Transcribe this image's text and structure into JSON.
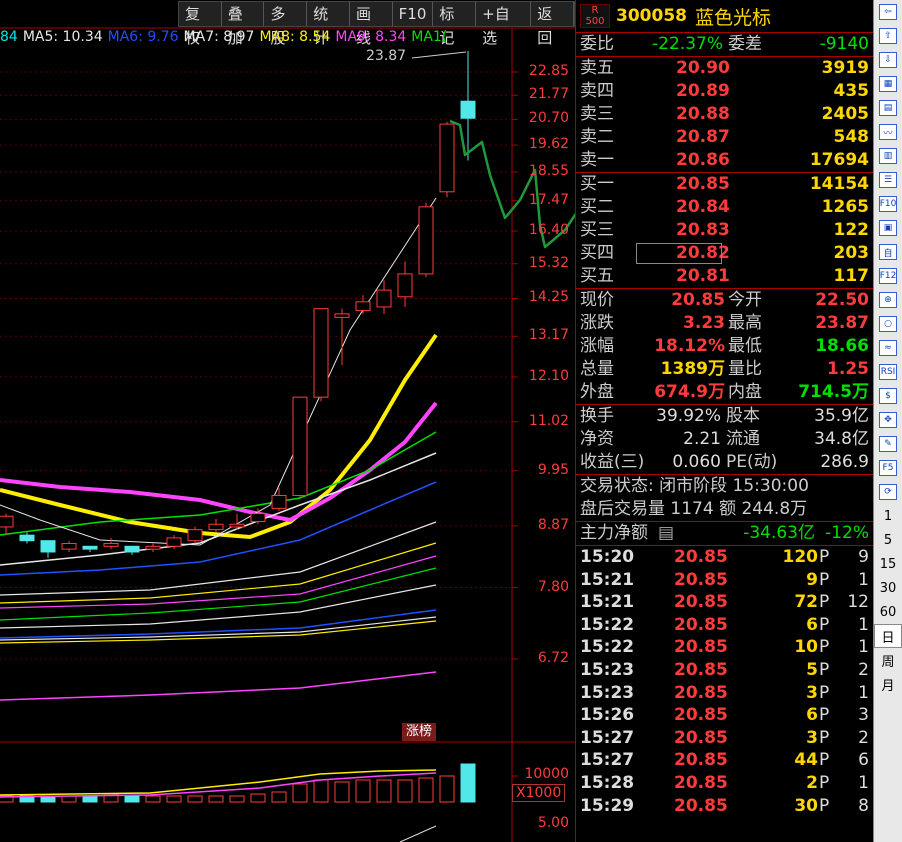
{
  "toolbar": [
    "复权",
    "叠加",
    "多股",
    "统计",
    "画线",
    "F10",
    "标记",
    "+自选",
    "返回"
  ],
  "ma_legend": [
    {
      "label": "84",
      "color": "#00e5e5"
    },
    {
      "label": "MA5: 10.34",
      "color": "#e6e6e6"
    },
    {
      "label": "MA6: 9.76",
      "color": "#2050ff"
    },
    {
      "label": "MA7: 8.97",
      "color": "#e6e6e6"
    },
    {
      "label": "MA8: 8.54",
      "color": "#ffee00"
    },
    {
      "label": "MA9: 8.34",
      "color": "#ff44ff"
    },
    {
      "label": "MA1(",
      "color": "#00e000"
    }
  ],
  "chart_data": {
    "type": "candlestick",
    "price_axis": [
      "22.85",
      "21.77",
      "20.70",
      "19.62",
      "18.55",
      "17.47",
      "16.40",
      "15.32",
      "14.25",
      "13.17",
      "12.10",
      "11.02",
      "9.95",
      "8.87",
      "7.80",
      "6.72"
    ],
    "max_label": "23.87",
    "volume_axis": [
      "10000",
      "5.00"
    ],
    "volume_unit": "X1000",
    "badge": "涨榜",
    "candles": [
      {
        "o": 8.85,
        "c": 9.05,
        "h": 9.1,
        "l": 8.7
      },
      {
        "o": 8.7,
        "c": 8.6,
        "h": 8.75,
        "l": 8.55
      },
      {
        "o": 8.6,
        "c": 8.4,
        "h": 8.6,
        "l": 8.3
      },
      {
        "o": 8.45,
        "c": 8.55,
        "h": 8.6,
        "l": 8.4
      },
      {
        "o": 8.5,
        "c": 8.45,
        "h": 8.5,
        "l": 8.4
      },
      {
        "o": 8.5,
        "c": 8.55,
        "h": 8.65,
        "l": 8.45
      },
      {
        "o": 8.5,
        "c": 8.4,
        "h": 8.5,
        "l": 8.35
      },
      {
        "o": 8.45,
        "c": 8.5,
        "h": 8.55,
        "l": 8.4
      },
      {
        "o": 8.5,
        "c": 8.65,
        "h": 8.7,
        "l": 8.45
      },
      {
        "o": 8.6,
        "c": 8.8,
        "h": 8.85,
        "l": 8.55
      },
      {
        "o": 8.8,
        "c": 8.9,
        "h": 9.0,
        "l": 8.75
      },
      {
        "o": 8.85,
        "c": 8.9,
        "h": 9.1,
        "l": 8.8
      },
      {
        "o": 8.95,
        "c": 9.1,
        "h": 9.2,
        "l": 8.9
      },
      {
        "o": 9.2,
        "c": 9.45,
        "h": 9.6,
        "l": 9.15
      },
      {
        "o": 9.45,
        "c": 11.6,
        "h": 11.6,
        "l": 9.4
      },
      {
        "o": 11.6,
        "c": 13.95,
        "h": 13.95,
        "l": 11.5
      },
      {
        "o": 13.7,
        "c": 13.8,
        "h": 13.95,
        "l": 12.4
      },
      {
        "o": 13.9,
        "c": 14.15,
        "h": 14.35,
        "l": 13.8
      },
      {
        "o": 14.0,
        "c": 14.5,
        "h": 14.8,
        "l": 13.8
      },
      {
        "o": 14.3,
        "c": 15.0,
        "h": 15.4,
        "l": 14.0
      },
      {
        "o": 15.0,
        "c": 17.25,
        "h": 17.4,
        "l": 14.9
      },
      {
        "o": 17.8,
        "c": 20.5,
        "h": 20.6,
        "l": 17.6
      },
      {
        "o": 21.5,
        "c": 20.75,
        "h": 23.87,
        "l": 19.0
      }
    ],
    "volumes": [
      3,
      3,
      3,
      3,
      3,
      4,
      3,
      3,
      3,
      3,
      3,
      3,
      4,
      5,
      9,
      11,
      10,
      11,
      11,
      11,
      12,
      13,
      19
    ]
  },
  "quote": {
    "r_badge": "R",
    "r_sub": "500",
    "code": "300058",
    "name": "蓝色光标",
    "weibi_label": "委比",
    "weibi_value": "-22.37%",
    "weicha_label": "委差",
    "weicha_value": "-9140",
    "asks": [
      {
        "label": "卖五",
        "price": "20.90",
        "vol": "3919"
      },
      {
        "label": "卖四",
        "price": "20.89",
        "vol": "435"
      },
      {
        "label": "卖三",
        "price": "20.88",
        "vol": "2405"
      },
      {
        "label": "卖二",
        "price": "20.87",
        "vol": "548"
      },
      {
        "label": "卖一",
        "price": "20.86",
        "vol": "17694"
      }
    ],
    "bids": [
      {
        "label": "买一",
        "price": "20.85",
        "vol": "14154"
      },
      {
        "label": "买二",
        "price": "20.84",
        "vol": "1265"
      },
      {
        "label": "买三",
        "price": "20.83",
        "vol": "122"
      },
      {
        "label": "买四",
        "price": "20.82",
        "vol": "203"
      },
      {
        "label": "买五",
        "price": "20.81",
        "vol": "117"
      }
    ],
    "stats": [
      {
        "l1": "现价",
        "v1": "20.85",
        "c1": "red",
        "l2": "今开",
        "v2": "22.50",
        "c2": "red"
      },
      {
        "l1": "涨跌",
        "v1": "3.23",
        "c1": "red",
        "l2": "最高",
        "v2": "23.87",
        "c2": "red"
      },
      {
        "l1": "涨幅",
        "v1": "18.12%",
        "c1": "red",
        "l2": "最低",
        "v2": "18.66",
        "c2": "green"
      },
      {
        "l1": "总量",
        "v1": "1389万",
        "c1": "yellow",
        "l2": "量比",
        "v2": "1.25",
        "c2": "red"
      },
      {
        "l1": "外盘",
        "v1": "674.9万",
        "c1": "red",
        "l2": "内盘",
        "v2": "714.5万",
        "c2": "green"
      }
    ],
    "fund": [
      {
        "l1": "换手",
        "v1": "39.92%",
        "l2": "股本",
        "v2": "35.9亿"
      },
      {
        "l1": "净资",
        "v1": "2.21",
        "l2": "流通",
        "v2": "34.8亿"
      },
      {
        "l1": "收益(三)",
        "v1": "0.060",
        "l2": "PE(动)",
        "v2": "286.9"
      }
    ],
    "trade_status": "交易状态: 闭市阶段 15:30:00",
    "after_hours": "盘后交易量 1174 额 244.8万",
    "main_net_label": "主力净额",
    "main_net_value": "-34.63亿",
    "main_net_pct": "-12%",
    "ticks": [
      {
        "t": "15:20",
        "p": "20.85",
        "v": "120",
        "f": "P",
        "n": "9"
      },
      {
        "t": "15:21",
        "p": "20.85",
        "v": "9",
        "f": "P",
        "n": "1"
      },
      {
        "t": "15:21",
        "p": "20.85",
        "v": "72",
        "f": "P",
        "n": "12"
      },
      {
        "t": "15:22",
        "p": "20.85",
        "v": "6",
        "f": "P",
        "n": "1"
      },
      {
        "t": "15:22",
        "p": "20.85",
        "v": "10",
        "f": "P",
        "n": "1"
      },
      {
        "t": "15:23",
        "p": "20.85",
        "v": "5",
        "f": "P",
        "n": "2"
      },
      {
        "t": "15:23",
        "p": "20.85",
        "v": "3",
        "f": "P",
        "n": "1"
      },
      {
        "t": "15:26",
        "p": "20.85",
        "v": "6",
        "f": "P",
        "n": "3"
      },
      {
        "t": "15:27",
        "p": "20.85",
        "v": "3",
        "f": "P",
        "n": "2"
      },
      {
        "t": "15:27",
        "p": "20.85",
        "v": "44",
        "f": "P",
        "n": "6"
      },
      {
        "t": "15:28",
        "p": "20.85",
        "v": "2",
        "f": "P",
        "n": "1"
      },
      {
        "t": "15:29",
        "p": "20.85",
        "v": "30",
        "f": "P",
        "n": "8"
      }
    ]
  },
  "sidebar": [
    {
      "icon": "arrow-left-icon",
      "text": "⇦"
    },
    {
      "icon": "arrow-up-icon",
      "text": "⇧"
    },
    {
      "icon": "arrow-down-icon",
      "text": "⇩"
    },
    {
      "icon": "calendar-icon",
      "text": "▦"
    },
    {
      "icon": "grid-icon",
      "text": "▤"
    },
    {
      "icon": "line-chart-icon",
      "text": "〰"
    },
    {
      "icon": "kline-icon",
      "text": "▥"
    },
    {
      "icon": "list-icon",
      "text": "☰"
    },
    {
      "icon": "f10-icon",
      "text": "F10"
    },
    {
      "icon": "document-icon",
      "text": "▣"
    },
    {
      "icon": "self-select-icon",
      "text": "自"
    },
    {
      "icon": "f12-icon",
      "text": "F12"
    },
    {
      "icon": "analysis-icon",
      "text": "⊕"
    },
    {
      "icon": "circle-icon",
      "text": "○"
    },
    {
      "icon": "wave-icon",
      "text": "≈"
    },
    {
      "icon": "rsi-icon",
      "text": "RSI"
    },
    {
      "icon": "dollar-icon",
      "text": "$"
    },
    {
      "icon": "move-icon",
      "text": "✥"
    },
    {
      "icon": "pencil-icon",
      "text": "✎"
    },
    {
      "icon": "f5-icon",
      "text": "F5"
    },
    {
      "icon": "refresh-icon",
      "text": "⟳"
    },
    {
      "icon": "period-1",
      "text": "1"
    },
    {
      "icon": "period-5",
      "text": "5"
    },
    {
      "icon": "period-15",
      "text": "15"
    },
    {
      "icon": "period-30",
      "text": "30"
    },
    {
      "icon": "period-60",
      "text": "60"
    },
    {
      "icon": "period-day",
      "text": "日"
    },
    {
      "icon": "period-week",
      "text": "周"
    },
    {
      "icon": "period-month",
      "text": "月"
    }
  ]
}
